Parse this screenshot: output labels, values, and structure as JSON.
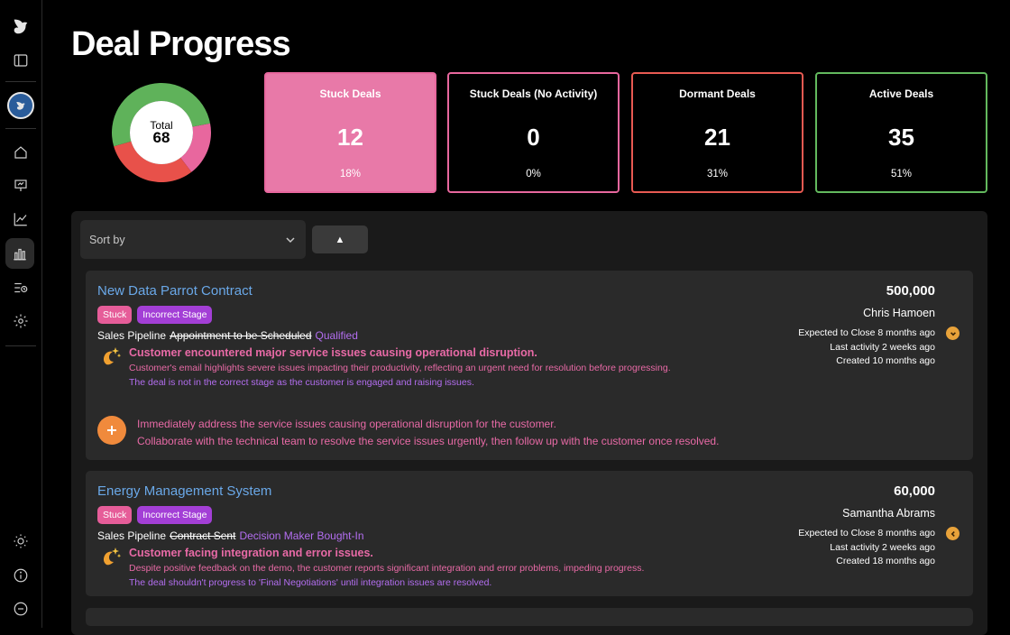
{
  "page": {
    "title": "Deal Progress"
  },
  "summary": {
    "total_label": "Total",
    "total_value": "68",
    "donut_segments": [
      {
        "name": "Stuck Deals",
        "value": 12,
        "color": "#e8679e"
      },
      {
        "name": "Stuck Deals (No Activity)",
        "value": 0,
        "color": "#e8679e"
      },
      {
        "name": "Dormant Deals",
        "value": 21,
        "color": "#e8514a"
      },
      {
        "name": "Active Deals",
        "value": 35,
        "color": "#5fb25a"
      }
    ],
    "cards": [
      {
        "label": "Stuck Deals",
        "value": "12",
        "percent": "18%",
        "border": "#e8679e",
        "bg": "#e879a8"
      },
      {
        "label": "Stuck Deals (No Activity)",
        "value": "0",
        "percent": "0%",
        "border": "#e8679e",
        "bg": "#000000"
      },
      {
        "label": "Dormant Deals",
        "value": "21",
        "percent": "31%",
        "border": "#e85a52",
        "bg": "#000000"
      },
      {
        "label": "Active Deals",
        "value": "35",
        "percent": "51%",
        "border": "#63b95e",
        "bg": "#000000"
      }
    ]
  },
  "controls": {
    "sort_placeholder": "Sort by",
    "sort_direction": "▲"
  },
  "deals": [
    {
      "title": "New Data Parrot Contract",
      "amount": "500,000",
      "owner": "Chris Hamoen",
      "tags": [
        "Stuck",
        "Incorrect Stage"
      ],
      "pipeline": "Sales Pipeline",
      "old_stage": "Appointment to be Scheduled",
      "new_stage": "Qualified",
      "expected": "Expected to Close 8 months ago",
      "last_activity": "Last activity 2 weeks ago",
      "created": "Created 10 months ago",
      "insight_title": "Customer encountered major service issues causing operational disruption.",
      "insight_detail": "Customer's email highlights severe issues impacting their productivity, reflecting an urgent need for resolution before progressing.",
      "insight_stage": "The deal is not in the correct stage as the customer is engaged and raising issues.",
      "action_1": "Immediately address the service issues causing operational disruption for the customer.",
      "action_2": "Collaborate with the technical team to resolve the service issues urgently, then follow up with the customer once resolved."
    },
    {
      "title": "Energy Management System",
      "amount": "60,000",
      "owner": "Samantha Abrams",
      "tags": [
        "Stuck",
        "Incorrect Stage"
      ],
      "pipeline": "Sales Pipeline",
      "old_stage": "Contract Sent",
      "new_stage": "Decision Maker Bought-In",
      "expected": "Expected to Close 8 months ago",
      "last_activity": "Last activity 2 weeks ago",
      "created": "Created 18 months ago",
      "insight_title": "Customer facing integration and error issues.",
      "insight_detail": "Despite positive feedback on the demo, the customer reports significant integration and error problems, impeding progress.",
      "insight_stage": "The deal shouldn't progress to 'Final Negotiations' until integration issues are resolved."
    }
  ]
}
